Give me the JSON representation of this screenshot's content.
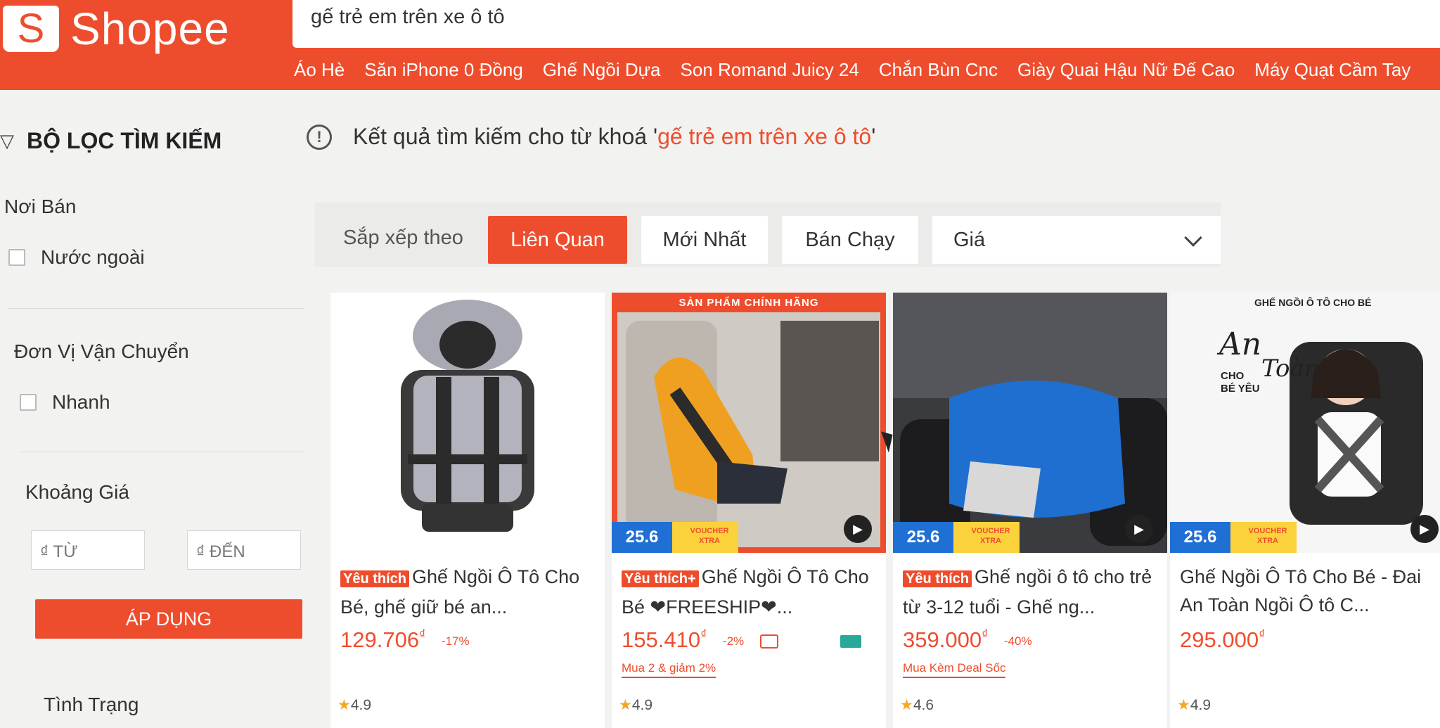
{
  "header": {
    "brand": "Shopee",
    "logo_letter": "S",
    "search_value": "gế trẻ em trên xe ô tô",
    "keywords": [
      "Áo Hè",
      "Săn iPhone 0 Đồng",
      "Ghế Ngồi Dựa",
      "Son Romand Juicy 24",
      "Chắn Bùn Cnc",
      "Giày Quai Hậu Nữ Đế Cao",
      "Máy Quạt Cầm Tay"
    ]
  },
  "sidebar": {
    "title": "BỘ LỌC TÌM KIẾM",
    "seller_heading": "Nơi Bán",
    "seller_option": "Nước ngoài",
    "shipping_heading": "Đơn Vị Vận Chuyển",
    "shipping_option": "Nhanh",
    "price_heading": "Khoảng Giá",
    "price_from_placeholder": "₫ TỪ",
    "price_to_placeholder": "₫ ĐẾN",
    "apply_label": "ÁP DỤNG",
    "condition_heading": "Tình Trạng"
  },
  "result": {
    "prefix": "Kết quả tìm kiếm cho từ khoá '",
    "keyword": "gế trẻ em trên xe ô tô",
    "suffix": "'"
  },
  "sort": {
    "label": "Sắp xếp theo",
    "options": [
      "Liên Quan",
      "Mới Nhất",
      "Bán Chạy"
    ],
    "active": "Liên Quan",
    "price_label": "Giá"
  },
  "products": [
    {
      "badge": "Yêu thích",
      "title": "Ghế Ngồi Ô Tô Cho Bé, ghế giữ bé an...",
      "price": "129.706",
      "currency": "₫",
      "discount": "-17%",
      "deal": "",
      "rating": "4.9",
      "image_banner": "",
      "promo": ""
    },
    {
      "badge": "Yêu thích+",
      "title": "Ghế Ngồi Ô Tô Cho Bé ❤FREESHIP❤...",
      "price": "155.410",
      "currency": "₫",
      "discount": "-2%",
      "deal": "Mua 2 & giảm 2%",
      "rating": "4.9",
      "image_banner": "SẢN PHẨM CHÍNH HÃNG",
      "promo": "25.6"
    },
    {
      "badge": "Yêu thích",
      "title": "Ghế ngồi ô tô cho trẻ từ 3-12 tuổi - Ghế ng...",
      "price": "359.000",
      "currency": "₫",
      "discount": "-40%",
      "deal": "Mua Kèm Deal Sốc",
      "rating": "4.6",
      "image_banner": "",
      "promo": "25.6"
    },
    {
      "badge": "",
      "title": "Ghế Ngồi Ô Tô Cho Bé - Đai An Toàn Ngồi Ô tô C...",
      "price": "295.000",
      "currency": "₫",
      "discount": "",
      "deal": "",
      "rating": "4.9",
      "image_banner": "GHẾ NGỒI Ô TÔ CHO BÉ",
      "promo": "25.6"
    }
  ],
  "promo_voucher_text": "VOUCHER XTRA",
  "image_text_4": {
    "script_1": "An",
    "script_2": "Toàn",
    "line_1": "CHO",
    "line_2": "BÉ YÊU"
  }
}
